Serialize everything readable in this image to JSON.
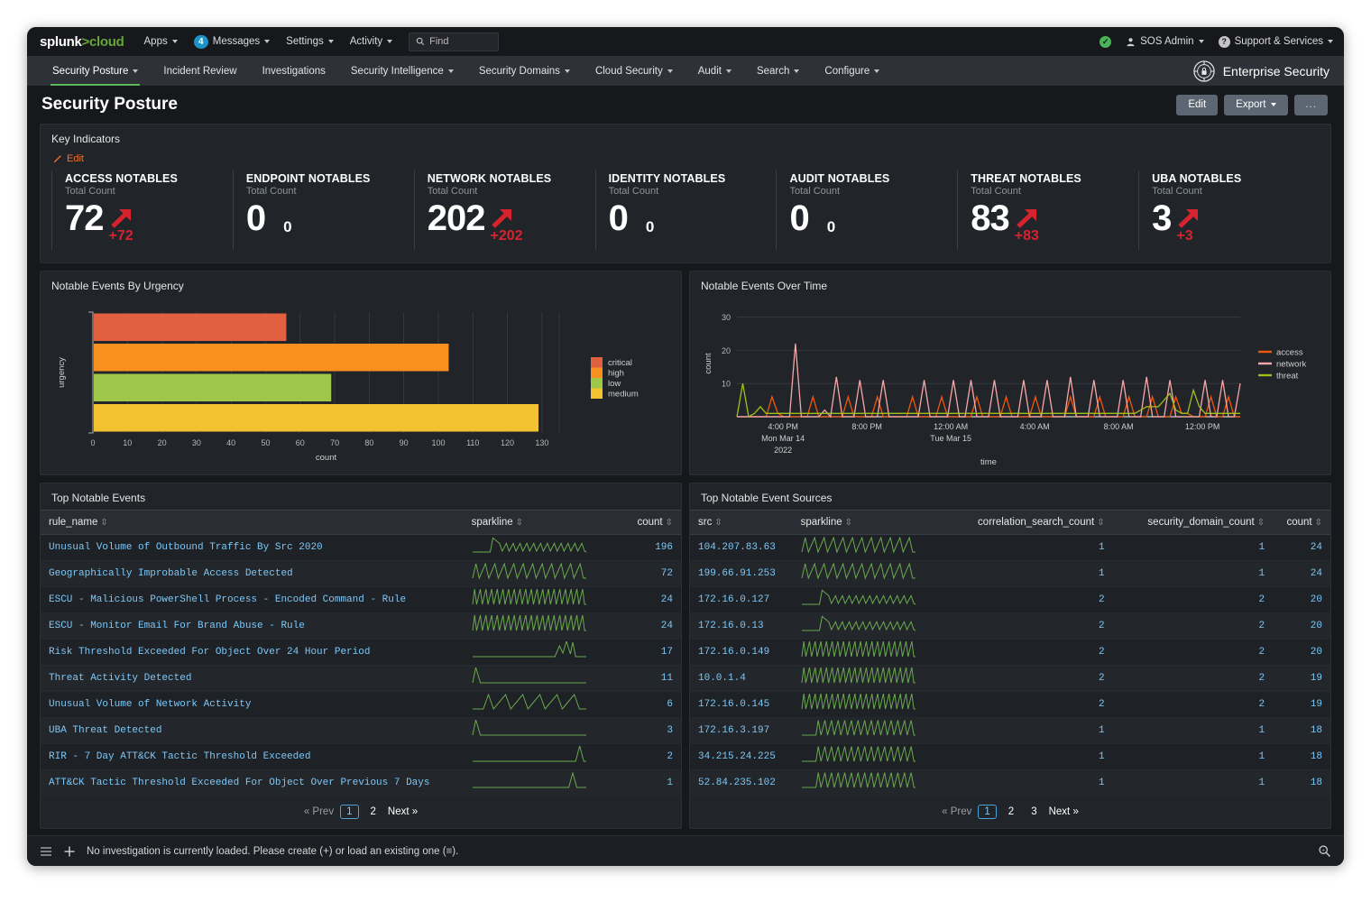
{
  "topbar": {
    "logo": "splunk>cloud",
    "logo_parts": {
      "splunk": "splunk",
      "gt": ">",
      "cloud": "cloud"
    },
    "items": [
      {
        "label": "Apps",
        "caret": true
      },
      {
        "label": "Messages",
        "caret": true,
        "badge": "4"
      },
      {
        "label": "Settings",
        "caret": true
      },
      {
        "label": "Activity",
        "caret": true
      }
    ],
    "find_placeholder": "Find",
    "status_icon": "check-circle-icon",
    "user": "SOS Admin",
    "support": "Support & Services"
  },
  "appnav": {
    "items": [
      {
        "label": "Security Posture",
        "caret": true,
        "active": true
      },
      {
        "label": "Incident Review",
        "caret": false,
        "active": false
      },
      {
        "label": "Investigations",
        "caret": false,
        "active": false
      },
      {
        "label": "Security Intelligence",
        "caret": true,
        "active": false
      },
      {
        "label": "Security Domains",
        "caret": true,
        "active": false
      },
      {
        "label": "Cloud Security",
        "caret": true,
        "active": false
      },
      {
        "label": "Audit",
        "caret": true,
        "active": false
      },
      {
        "label": "Search",
        "caret": true,
        "active": false
      },
      {
        "label": "Configure",
        "caret": true,
        "active": false
      }
    ],
    "app_name": "Enterprise Security"
  },
  "page": {
    "title": "Security Posture",
    "edit_label": "Edit",
    "export_label": "Export",
    "more_label": "..."
  },
  "key_indicators": {
    "panel_title": "Key Indicators",
    "edit_label": "Edit",
    "cards": [
      {
        "label": "ACCESS NOTABLES",
        "sub": "Total Count",
        "value": "72",
        "delta": "+72",
        "trend": "up"
      },
      {
        "label": "ENDPOINT NOTABLES",
        "sub": "Total Count",
        "value": "0",
        "delta": "0",
        "trend": "flat"
      },
      {
        "label": "NETWORK NOTABLES",
        "sub": "Total Count",
        "value": "202",
        "delta": "+202",
        "trend": "up"
      },
      {
        "label": "IDENTITY NOTABLES",
        "sub": "Total Count",
        "value": "0",
        "delta": "0",
        "trend": "flat"
      },
      {
        "label": "AUDIT NOTABLES",
        "sub": "Total Count",
        "value": "0",
        "delta": "0",
        "trend": "flat"
      },
      {
        "label": "THREAT NOTABLES",
        "sub": "Total Count",
        "value": "83",
        "delta": "+83",
        "trend": "up"
      },
      {
        "label": "UBA NOTABLES",
        "sub": "Total Count",
        "value": "3",
        "delta": "+3",
        "trend": "up"
      }
    ],
    "trend_color": "#d6232e"
  },
  "chart_data": [
    {
      "type": "bar",
      "orientation": "horizontal",
      "title": "Notable Events By Urgency",
      "categories": [
        "critical",
        "high",
        "low",
        "medium"
      ],
      "values": [
        56,
        103,
        69,
        129
      ],
      "colors": [
        "#e0603f",
        "#f7901e",
        "#9fc84b",
        "#f2c230"
      ],
      "xlabel": "count",
      "ylabel": "urgency",
      "xlim": [
        0,
        135
      ],
      "xticks": [
        0,
        10,
        20,
        30,
        40,
        50,
        60,
        70,
        80,
        90,
        100,
        110,
        120,
        130
      ],
      "grid": true,
      "legend": {
        "position": "right",
        "entries": [
          "critical",
          "high",
          "low",
          "medium"
        ]
      }
    },
    {
      "type": "line",
      "title": "Notable Events Over Time",
      "xlabel": "time",
      "ylabel": "count",
      "ylim": [
        0,
        32
      ],
      "yticks": [
        10,
        20,
        30
      ],
      "grid": true,
      "xtick_labels": [
        "4:00 PM",
        "8:00 PM",
        "12:00 AM",
        "4:00 AM",
        "8:00 AM",
        "12:00 PM"
      ],
      "xtick_sublabels": [
        "Mon Mar 14",
        "",
        "Tue Mar 15",
        "",
        "",
        ""
      ],
      "year_label": "2022",
      "legend": {
        "position": "right",
        "entries": [
          "access",
          "network",
          "threat"
        ]
      },
      "series": [
        {
          "name": "access",
          "color": "#f1580c",
          "values": [
            0,
            0,
            0,
            0,
            0,
            0,
            6,
            1,
            0,
            0,
            0,
            0,
            0,
            6,
            0,
            0,
            0,
            0,
            0,
            6,
            0,
            0,
            0,
            0,
            6,
            0,
            0,
            0,
            0,
            0,
            6,
            0,
            0,
            0,
            0,
            6,
            0,
            0,
            0,
            0,
            0,
            6,
            0,
            0,
            0,
            0,
            6,
            0,
            0,
            0,
            0,
            6,
            0,
            0,
            0,
            0,
            0,
            6,
            0,
            0,
            0,
            0,
            6,
            0,
            0,
            0,
            0,
            6,
            0,
            0,
            0,
            6,
            0,
            0,
            0,
            6,
            1,
            1,
            0,
            0,
            0,
            6,
            0,
            0,
            6,
            0,
            0
          ]
        },
        {
          "name": "network",
          "color": "#f7a7a7",
          "values": [
            0,
            0,
            0,
            0,
            0,
            0,
            0,
            0,
            0,
            0,
            22,
            0,
            0,
            0,
            0,
            2,
            0,
            12,
            0,
            0,
            0,
            11,
            0,
            0,
            0,
            11,
            0,
            0,
            0,
            0,
            0,
            0,
            11,
            0,
            0,
            0,
            0,
            11,
            0,
            0,
            11,
            0,
            0,
            0,
            11,
            0,
            0,
            0,
            0,
            11,
            0,
            0,
            0,
            11,
            0,
            0,
            0,
            12,
            0,
            0,
            0,
            11,
            0,
            0,
            0,
            0,
            11,
            0,
            0,
            0,
            12,
            0,
            0,
            0,
            11,
            0,
            0,
            0,
            0,
            0,
            11,
            0,
            0,
            11,
            0,
            0,
            10
          ]
        },
        {
          "name": "threat",
          "color": "#9fc01c",
          "values": [
            0,
            10,
            0,
            1,
            3,
            1,
            1,
            1,
            1,
            1,
            1,
            1,
            1,
            1,
            1,
            1,
            1,
            1,
            1,
            1,
            1,
            1,
            1,
            1,
            1,
            1,
            1,
            1,
            1,
            1,
            1,
            1,
            1,
            1,
            1,
            1,
            1,
            1,
            1,
            1,
            1,
            1,
            1,
            1,
            1,
            1,
            1,
            1,
            1,
            1,
            1,
            1,
            1,
            1,
            1,
            1,
            1,
            1,
            1,
            1,
            1,
            1,
            1,
            1,
            1,
            1,
            1,
            1,
            1,
            2,
            3,
            3,
            3,
            5,
            7,
            2,
            1,
            1,
            8,
            3,
            1,
            1,
            1,
            1,
            1,
            1,
            1
          ]
        }
      ]
    }
  ],
  "top_notable_events": {
    "panel_title": "Top Notable Events",
    "columns": [
      "rule_name",
      "sparkline",
      "count"
    ],
    "rows": [
      {
        "rule_name": "Unusual Volume of Outbound Traffic By Src 2020",
        "count": "196",
        "spark": "dense-wave-rising"
      },
      {
        "rule_name": "Geographically Improbable Access Detected",
        "count": "72",
        "spark": "regular-spikes"
      },
      {
        "rule_name": "ESCU - Malicious PowerShell Process - Encoded Command - Rule",
        "count": "24",
        "spark": "very-dense-wave"
      },
      {
        "rule_name": "ESCU - Monitor Email For Brand Abuse - Rule",
        "count": "24",
        "spark": "very-dense-wave"
      },
      {
        "rule_name": "Risk Threshold Exceeded For Object Over 24 Hour Period",
        "count": "17",
        "spark": "flat-late-spikes"
      },
      {
        "rule_name": "Threat Activity Detected",
        "count": "11",
        "spark": "early-spike-flat"
      },
      {
        "rule_name": "Unusual Volume of Network Activity",
        "count": "6",
        "spark": "six-spikes"
      },
      {
        "rule_name": "UBA Threat Detected",
        "count": "3",
        "spark": "early-spike-flat"
      },
      {
        "rule_name": "RIR - 7 Day ATT&CK Tactic Threshold Exceeded",
        "count": "2",
        "spark": "flat-end-spike"
      },
      {
        "rule_name": "ATT&CK Tactic Threshold Exceeded For Object Over Previous 7 Days",
        "count": "1",
        "spark": "flat-one-spike"
      }
    ],
    "pager": {
      "prev": "« Prev",
      "pages": [
        "1",
        "2"
      ],
      "active": "1",
      "next": "Next »"
    }
  },
  "top_notable_event_sources": {
    "panel_title": "Top Notable Event Sources",
    "columns": [
      "src",
      "sparkline",
      "correlation_search_count",
      "security_domain_count",
      "count"
    ],
    "rows": [
      {
        "src": "104.207.83.63",
        "correlation_search_count": "1",
        "security_domain_count": "1",
        "count": "24",
        "spark": "regular-spikes"
      },
      {
        "src": "199.66.91.253",
        "correlation_search_count": "1",
        "security_domain_count": "1",
        "count": "24",
        "spark": "regular-spikes"
      },
      {
        "src": "172.16.0.127",
        "correlation_search_count": "2",
        "security_domain_count": "2",
        "count": "20",
        "spark": "dense-wave-rising"
      },
      {
        "src": "172.16.0.13",
        "correlation_search_count": "2",
        "security_domain_count": "2",
        "count": "20",
        "spark": "dense-wave-rising"
      },
      {
        "src": "172.16.0.149",
        "correlation_search_count": "2",
        "security_domain_count": "2",
        "count": "20",
        "spark": "very-dense-wave"
      },
      {
        "src": "10.0.1.4",
        "correlation_search_count": "2",
        "security_domain_count": "2",
        "count": "19",
        "spark": "very-dense-wave"
      },
      {
        "src": "172.16.0.145",
        "correlation_search_count": "2",
        "security_domain_count": "2",
        "count": "19",
        "spark": "very-dense-wave"
      },
      {
        "src": "172.16.3.197",
        "correlation_search_count": "1",
        "security_domain_count": "1",
        "count": "18",
        "spark": "flat-then-dense"
      },
      {
        "src": "34.215.24.225",
        "correlation_search_count": "1",
        "security_domain_count": "1",
        "count": "18",
        "spark": "flat-then-dense"
      },
      {
        "src": "52.84.235.102",
        "correlation_search_count": "1",
        "security_domain_count": "1",
        "count": "18",
        "spark": "flat-then-dense"
      }
    ],
    "pager": {
      "prev": "« Prev",
      "pages": [
        "1",
        "2",
        "3"
      ],
      "active": "1",
      "next": "Next »"
    }
  },
  "footer": {
    "text": "No investigation is currently loaded. Please create (+) or load an existing one (≡).",
    "list_icon": "list-icon",
    "plus_icon": "plus-icon",
    "search_icon": "magnifier-icon"
  }
}
